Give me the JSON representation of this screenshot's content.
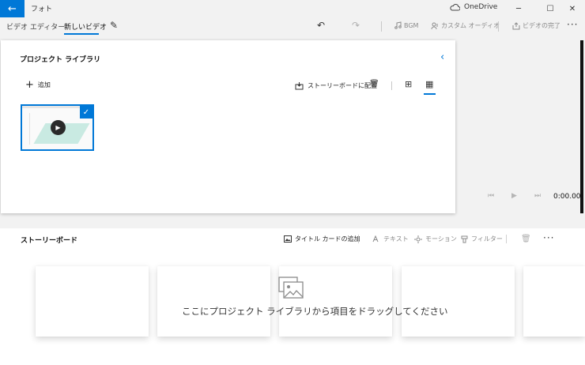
{
  "window": {
    "app_title": "フォト",
    "onedrive_label": "OneDrive",
    "back_glyph": "←",
    "minimize_glyph": "─",
    "maximize_glyph": "☐",
    "close_glyph": "✕"
  },
  "toolbar": {
    "breadcrumb_root": "ビデオ エディター",
    "breadcrumb_sep": "›",
    "breadcrumb_current": "新しいビデオ",
    "edit_glyph": "✎",
    "undo_glyph": "↶",
    "redo_glyph": "↷",
    "bgm_label": "BGM",
    "custom_audio_label": "カスタム オーディオ",
    "finish_video_label": "ビデオの完了",
    "more_glyph": "···"
  },
  "library": {
    "title": "プロジェクト ライブラリ",
    "collapse_glyph": "‹",
    "add_label": "追加",
    "add_glyph": "+",
    "place_in_storyboard_label": "ストーリーボードに配置",
    "trash_glyph": "🗑",
    "grid_small_glyph": "⊞",
    "grid_large_glyph": "▦",
    "thumbnail": {
      "selected": true,
      "play_glyph": "▶",
      "check_glyph": "✓"
    }
  },
  "preview": {
    "prev_glyph": "⏮",
    "play_glyph": "▶",
    "next_glyph": "⏭",
    "time": "0:00.00"
  },
  "storyboard": {
    "title": "ストーリーボード",
    "add_title_card_label": "タイトル カードの追加",
    "text_label": "テキスト",
    "motion_label": "モーション",
    "filter_label": "フィルター",
    "trash_glyph": "🗑",
    "more_glyph": "···",
    "empty_message": "ここにプロジェクト ライブラリから項目をドラッグしてください"
  },
  "colors": {
    "accent": "#0078d7",
    "disabled": "#8a8a8a",
    "background": "#f2f2f2"
  }
}
